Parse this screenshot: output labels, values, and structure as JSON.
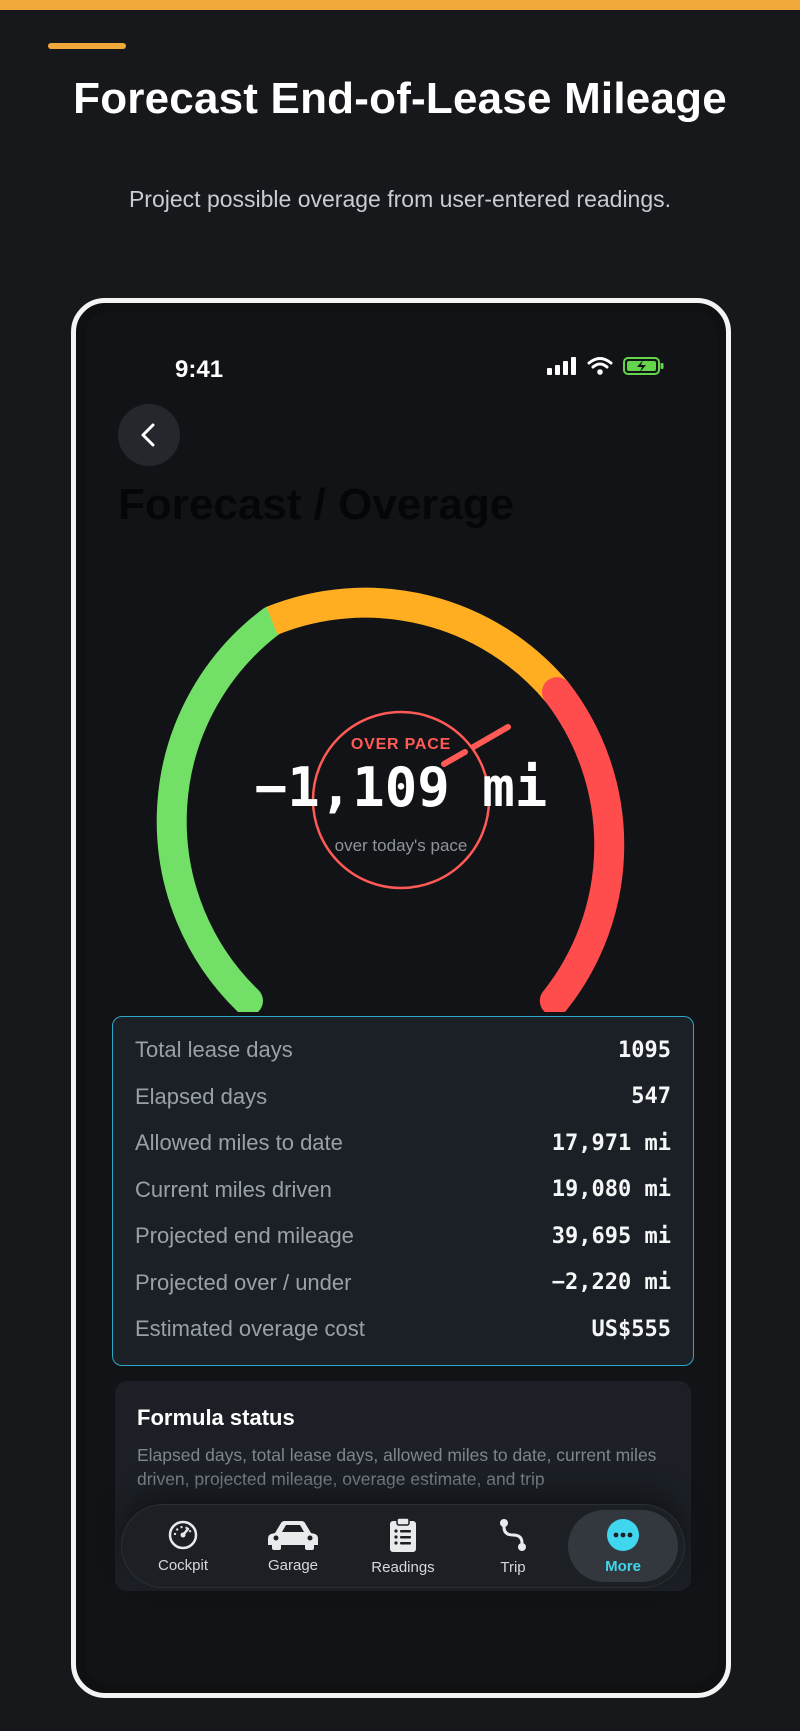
{
  "page": {
    "headline": "Forecast End-of-Lease Mileage",
    "subheadline": "Project possible overage from user-entered readings."
  },
  "status_bar": {
    "time": "9:41",
    "icons": [
      "cellular-signal-icon",
      "wifi-icon",
      "battery-charging-icon"
    ]
  },
  "screen": {
    "title": "Forecast / Overage",
    "back_icon": "chevron-left-icon"
  },
  "gauge": {
    "status_label": "OVER PACE",
    "value": "−1,109 mi",
    "caption": "over today's pace",
    "colors": {
      "green": "#72e066",
      "amber": "#ffae22",
      "red": "#ff4c4c"
    }
  },
  "stats": [
    {
      "label": "Total lease days",
      "value": "1095"
    },
    {
      "label": "Elapsed days",
      "value": "547"
    },
    {
      "label": "Allowed miles to date",
      "value": "17,971 mi"
    },
    {
      "label": "Current miles driven",
      "value": "19,080 mi"
    },
    {
      "label": "Projected end mileage",
      "value": "39,695 mi"
    },
    {
      "label": "Projected over / under",
      "value": "−2,220 mi"
    },
    {
      "label": "Estimated overage cost",
      "value": "US$555"
    }
  ],
  "formula": {
    "title": "Formula status",
    "text": "Elapsed days, total lease days, allowed miles to date, current miles driven, projected mileage, overage estimate, and trip"
  },
  "tabs": [
    {
      "label": "Cockpit",
      "icon": "gauge-icon",
      "active": false
    },
    {
      "label": "Garage",
      "icon": "car-icon",
      "active": false
    },
    {
      "label": "Readings",
      "icon": "clipboard-list-icon",
      "active": false
    },
    {
      "label": "Trip",
      "icon": "route-icon",
      "active": false
    },
    {
      "label": "More",
      "icon": "more-dots-icon",
      "active": true
    }
  ],
  "colors": {
    "accent": "#f2a93b",
    "active_tab": "#3fd6ee",
    "card_border": "#2aa8c8"
  }
}
